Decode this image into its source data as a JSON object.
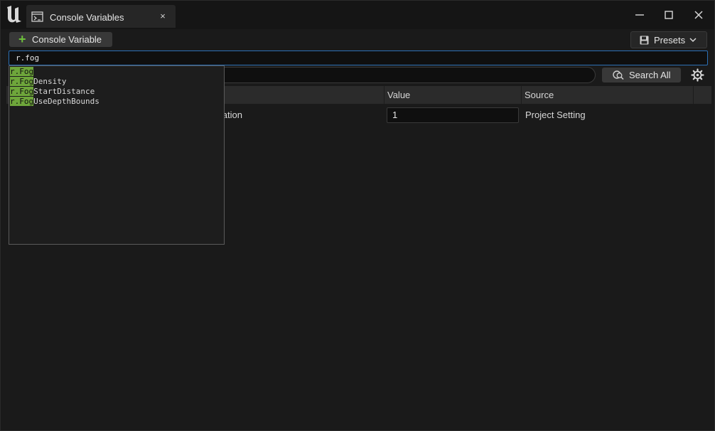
{
  "window": {
    "tab_title": "Console Variables",
    "tab_close": "×"
  },
  "toolbar": {
    "add_label": "Console Variable",
    "add_plus": "+",
    "presets_label": "Presets"
  },
  "command": {
    "value": "r.fog"
  },
  "search": {
    "search_all_label": "Search All"
  },
  "table": {
    "headers": {
      "value": "Value",
      "source": "Source"
    },
    "rows": [
      {
        "name_visible": "ilation",
        "value": "1",
        "source": "Project Setting"
      }
    ]
  },
  "autocomplete": {
    "match": "r.Fog",
    "items": [
      {
        "match": "r.Fog",
        "rest": ""
      },
      {
        "match": "r.Fog",
        "rest": "Density"
      },
      {
        "match": "r.Fog",
        "rest": "StartDistance"
      },
      {
        "match": "r.Fog",
        "rest": "UseDepthBounds"
      }
    ]
  },
  "colors": {
    "accent_focus": "#2b6fb5",
    "match_highlight": "#6ea63b",
    "add_plus": "#6ec13c"
  }
}
